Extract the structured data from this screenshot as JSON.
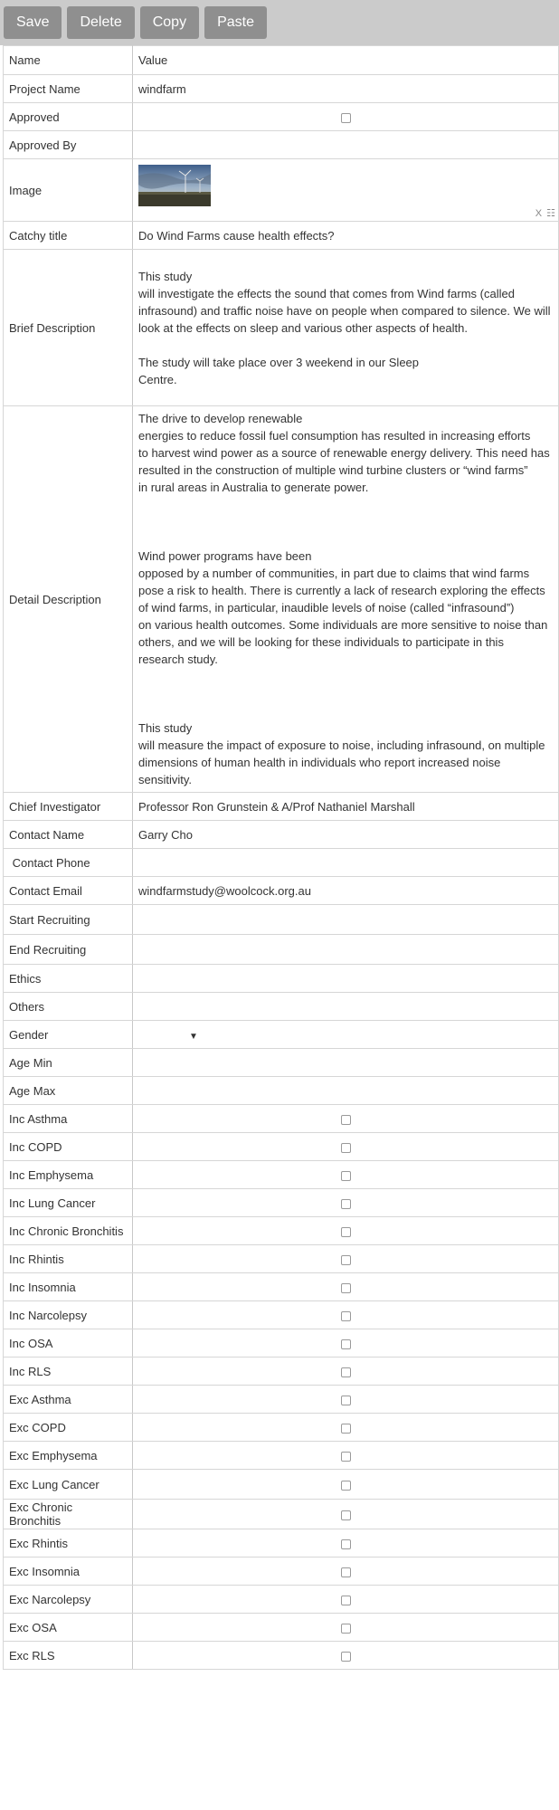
{
  "toolbar": {
    "save": "Save",
    "delete": "Delete",
    "copy": "Copy",
    "paste": "Paste"
  },
  "header": {
    "name": "Name",
    "value": "Value"
  },
  "fields": {
    "project_name": {
      "label": "Project Name",
      "value": "windfarm"
    },
    "approved": {
      "label": "Approved"
    },
    "approved_by": {
      "label": "Approved By",
      "value": ""
    },
    "image": {
      "label": "Image",
      "controls": "X ☷"
    },
    "catchy_title": {
      "label": "Catchy title",
      "value": "Do Wind Farms cause health effects?"
    },
    "brief_description": {
      "label": "Brief Description",
      "value": "This study\nwill investigate the effects the sound that comes from Wind farms (called infrasound) and traffic noise have on people when compared to silence. We will look at the effects on sleep and various other aspects of health.\n\nThe study will take place over 3 weekend in our Sleep\nCentre."
    },
    "detail_description": {
      "label": "Detail Description",
      "value": "The drive to develop renewable\nenergies to reduce fossil fuel consumption has resulted in increasing efforts\nto harvest wind power as a source of renewable energy delivery. This need has resulted in the construction of multiple wind turbine clusters or “wind farms”\nin rural areas in Australia to generate power.\n\n\n\nWind power programs have been\nopposed by a number of communities, in part due to claims that wind farms pose a risk to health. There is currently a lack of research exploring the effects\nof wind farms, in particular, inaudible levels of noise (called “infrasound”)\non various health outcomes. Some individuals are more sensitive to noise than others, and we will be looking for these individuals to participate in this research study.\n\n\n\nThis study\nwill measure the impact of exposure to noise, including infrasound, on multiple dimensions of human health in individuals who report increased noise sensitivity."
    },
    "chief_investigator": {
      "label": "Chief Investigator",
      "value": "Professor Ron Grunstein & A/Prof Nathaniel Marshall"
    },
    "contact_name": {
      "label": "Contact Name",
      "value": "Garry Cho"
    },
    "contact_phone": {
      "label": " Contact Phone",
      "value": ""
    },
    "contact_email": {
      "label": "Contact Email",
      "value": "windfarmstudy@woolcock.org.au"
    },
    "start_recruiting": {
      "label": "Start Recruiting",
      "value": ""
    },
    "end_recruiting": {
      "label": "End Recruiting",
      "value": ""
    },
    "ethics": {
      "label": "Ethics",
      "value": ""
    },
    "others": {
      "label": "Others",
      "value": ""
    },
    "gender": {
      "label": "Gender",
      "value": "",
      "arrow": "▼"
    },
    "age_min": {
      "label": "Age Min",
      "value": ""
    },
    "age_max": {
      "label": "Age Max",
      "value": ""
    }
  },
  "checkbox_rows": [
    "Inc Asthma",
    "Inc COPD",
    "Inc Emphysema",
    "Inc Lung Cancer",
    "Inc Chronic Bronchitis",
    "Inc Rhintis",
    "Inc Insomnia",
    "Inc Narcolepsy",
    "Inc OSA",
    "Inc RLS",
    "Exc Asthma",
    "Exc COPD",
    "Exc Emphysema",
    "Exc Lung Cancer",
    "Exc Chronic Bronchitis",
    "Exc Rhintis",
    "Exc Insomnia",
    "Exc Narcolepsy",
    "Exc OSA",
    "Exc RLS"
  ]
}
